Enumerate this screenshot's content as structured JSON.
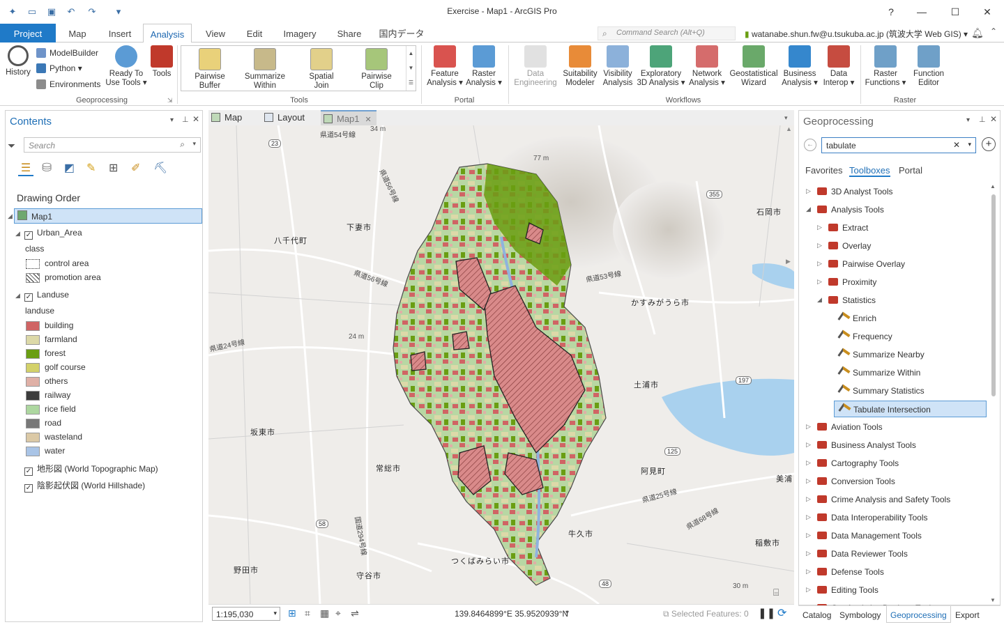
{
  "app": {
    "title": "Exercise - Map1 - ArcGIS Pro",
    "help": "?",
    "user": "watanabe.shun.fw@u.tsukuba.ac.jp (筑波大学 Web GIS)",
    "command_search": "Command Search (Alt+Q)"
  },
  "tabs": [
    "Project",
    "Map",
    "Insert",
    "Analysis",
    "View",
    "Edit",
    "Imagery",
    "Share",
    "国内データ"
  ],
  "ribbon": {
    "geoprocessing": {
      "label": "Geoprocessing",
      "history": "History",
      "modelbuilder": "ModelBuilder",
      "python": "Python",
      "environments": "Environments",
      "ready_to_use_1": "Ready To",
      "ready_to_use_2": "Use Tools",
      "tools": "Tools"
    },
    "tools": {
      "label": "Tools",
      "items": [
        [
          "Pairwise",
          "Buffer"
        ],
        [
          "Summarize",
          "Within"
        ],
        [
          "Spatial",
          "Join"
        ],
        [
          "Pairwise",
          "Clip"
        ]
      ]
    },
    "portal": {
      "label": "Portal",
      "items": [
        [
          "Feature",
          "Analysis"
        ],
        [
          "Raster",
          "Analysis"
        ]
      ]
    },
    "workflows": {
      "label": "Workflows",
      "items": [
        [
          "Data",
          "Engineering"
        ],
        [
          "Suitability",
          "Modeler"
        ],
        [
          "Visibility",
          "Analysis"
        ],
        [
          "Exploratory",
          "3D Analysis"
        ],
        [
          "Network",
          "Analysis"
        ],
        [
          "Geostatistical",
          "Wizard"
        ],
        [
          "Business",
          "Analysis"
        ],
        [
          "Data",
          "Interop"
        ]
      ]
    },
    "raster": {
      "label": "Raster",
      "items": [
        [
          "Raster",
          "Functions"
        ],
        [
          "Function",
          "Editor"
        ]
      ]
    }
  },
  "contents": {
    "title": "Contents",
    "search_placeholder": "Search",
    "drawing_order": "Drawing Order",
    "map": "Map1",
    "urban": {
      "name": "Urban_Area",
      "field": "class",
      "classes": [
        "control area",
        "promotion area"
      ]
    },
    "landuse": {
      "name": "Landuse",
      "field": "landuse",
      "classes": [
        {
          "label": "building",
          "color": "#d06464"
        },
        {
          "label": "farmland",
          "color": "#dcd9a8"
        },
        {
          "label": "forest",
          "color": "#6a9e12"
        },
        {
          "label": "golf course",
          "color": "#d3d169"
        },
        {
          "label": "others",
          "color": "#dfb0a6"
        },
        {
          "label": "railway",
          "color": "#3c3c3c"
        },
        {
          "label": "rice field",
          "color": "#add7a0"
        },
        {
          "label": "road",
          "color": "#787878"
        },
        {
          "label": "wasteland",
          "color": "#dbc9a6"
        },
        {
          "label": "water",
          "color": "#a9c4e6"
        }
      ]
    },
    "basemaps": [
      "地形図 (World Topographic Map)",
      "陰影起伏図 (World Hillshade)"
    ]
  },
  "view_tabs": [
    "Map",
    "Layout",
    "Map1"
  ],
  "map_labels": {
    "cities": [
      "下妻市",
      "八千代町",
      "石岡市",
      "かすみがうら市",
      "土浦市",
      "坂東市",
      "常総市",
      "阿見町",
      "美浦",
      "牛久市",
      "稲敷市",
      "つくばみらい市",
      "守谷市",
      "野田市"
    ],
    "roads": [
      "県道54号線",
      "県道56号線",
      "県道53号線",
      "県道24号線",
      "県道56号線",
      "県道25号線",
      "県道68号線",
      "国道294号線"
    ],
    "shields": [
      "23",
      "355",
      "197",
      "125",
      "58",
      "48"
    ],
    "elev": [
      "34 m",
      "77 m",
      "24 m",
      "30 m"
    ]
  },
  "status": {
    "scale": "1:195,030",
    "coords": "139.8464899°E 35.9520939°N",
    "selected": "Selected Features: 0"
  },
  "geoprocessing": {
    "title": "Geoprocessing",
    "search": "tabulate",
    "tabs": [
      "Favorites",
      "Toolboxes",
      "Portal"
    ],
    "tree": [
      {
        "t": "3D Analyst Tools",
        "lvl": 0,
        "kind": "box",
        "exp": "▷"
      },
      {
        "t": "Analysis Tools",
        "lvl": 0,
        "kind": "box",
        "exp": "◢"
      },
      {
        "t": "Extract",
        "lvl": 1,
        "kind": "box",
        "exp": "▷"
      },
      {
        "t": "Overlay",
        "lvl": 1,
        "kind": "box",
        "exp": "▷"
      },
      {
        "t": "Pairwise Overlay",
        "lvl": 1,
        "kind": "box",
        "exp": "▷"
      },
      {
        "t": "Proximity",
        "lvl": 1,
        "kind": "box",
        "exp": "▷"
      },
      {
        "t": "Statistics",
        "lvl": 1,
        "kind": "box",
        "exp": "◢"
      },
      {
        "t": "Enrich",
        "lvl": 2,
        "kind": "tool",
        "exp": ""
      },
      {
        "t": "Frequency",
        "lvl": 2,
        "kind": "tool",
        "exp": ""
      },
      {
        "t": "Summarize Nearby",
        "lvl": 2,
        "kind": "tool",
        "exp": ""
      },
      {
        "t": "Summarize Within",
        "lvl": 2,
        "kind": "tool",
        "exp": ""
      },
      {
        "t": "Summary Statistics",
        "lvl": 2,
        "kind": "tool",
        "exp": ""
      },
      {
        "t": "Tabulate Intersection",
        "lvl": 2,
        "kind": "tool",
        "exp": "",
        "sel": true
      },
      {
        "t": "Aviation Tools",
        "lvl": 0,
        "kind": "box",
        "exp": "▷"
      },
      {
        "t": "Business Analyst Tools",
        "lvl": 0,
        "kind": "box",
        "exp": "▷"
      },
      {
        "t": "Cartography Tools",
        "lvl": 0,
        "kind": "box",
        "exp": "▷"
      },
      {
        "t": "Conversion Tools",
        "lvl": 0,
        "kind": "box",
        "exp": "▷"
      },
      {
        "t": "Crime Analysis and Safety Tools",
        "lvl": 0,
        "kind": "box",
        "exp": "▷"
      },
      {
        "t": "Data Interoperability Tools",
        "lvl": 0,
        "kind": "box",
        "exp": "▷"
      },
      {
        "t": "Data Management Tools",
        "lvl": 0,
        "kind": "box",
        "exp": "▷"
      },
      {
        "t": "Data Reviewer Tools",
        "lvl": 0,
        "kind": "box",
        "exp": "▷"
      },
      {
        "t": "Defense Tools",
        "lvl": 0,
        "kind": "box",
        "exp": "▷"
      },
      {
        "t": "Editing Tools",
        "lvl": 0,
        "kind": "box",
        "exp": "▷"
      },
      {
        "t": "GeoAnalytics Desktop Tools",
        "lvl": 0,
        "kind": "box",
        "exp": "▷"
      }
    ],
    "bottom_tabs": [
      "Catalog",
      "Symbology",
      "Geoprocessing",
      "Export"
    ]
  },
  "colors": {
    "accent": "#1f7ac8",
    "selected": "#cfe3f7"
  }
}
